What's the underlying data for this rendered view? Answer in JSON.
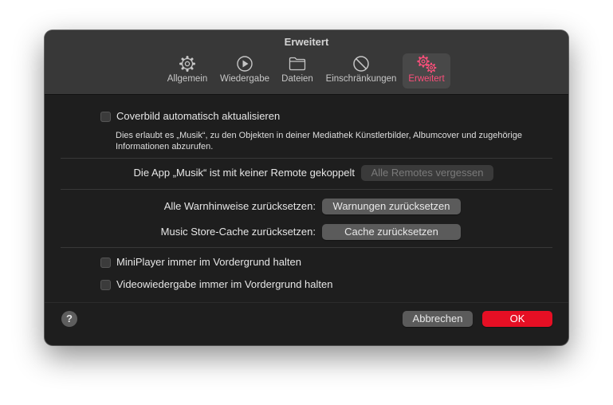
{
  "window": {
    "title": "Erweitert"
  },
  "tabs": [
    {
      "label": "Allgemein",
      "icon": "gear-icon"
    },
    {
      "label": "Wiedergabe",
      "icon": "play-circle-icon"
    },
    {
      "label": "Dateien",
      "icon": "folder-icon"
    },
    {
      "label": "Einschränkungen",
      "icon": "no-entry-icon"
    },
    {
      "label": "Erweitert",
      "icon": "gears-icon",
      "active": true
    }
  ],
  "cover": {
    "checkbox_label": "Coverbild automatisch aktualisieren",
    "checked": false,
    "description": "Dies erlaubt es „Musik“, zu den Objekten in deiner Mediathek Künstlerbilder, Albumcover und zugehörige Informationen abzurufen."
  },
  "remote": {
    "label": "Die App „Musik“ ist mit keiner Remote gekoppelt",
    "button": "Alle Remotes vergessen"
  },
  "warnings": {
    "label": "Alle Warnhinweise zurücksetzen:",
    "button": "Warnungen zurücksetzen"
  },
  "cache": {
    "label": "Music Store-Cache zurücksetzen:",
    "button": "Cache zurücksetzen"
  },
  "miniplayer": {
    "label": "MiniPlayer immer im Vordergrund halten",
    "checked": false
  },
  "video": {
    "label": "Videowiedergabe immer im Vordergrund halten",
    "checked": false
  },
  "footer": {
    "help": "?",
    "cancel": "Abbrechen",
    "ok": "OK"
  },
  "colors": {
    "accent": "#fa4f7a",
    "ok_button": "#e60f24"
  }
}
